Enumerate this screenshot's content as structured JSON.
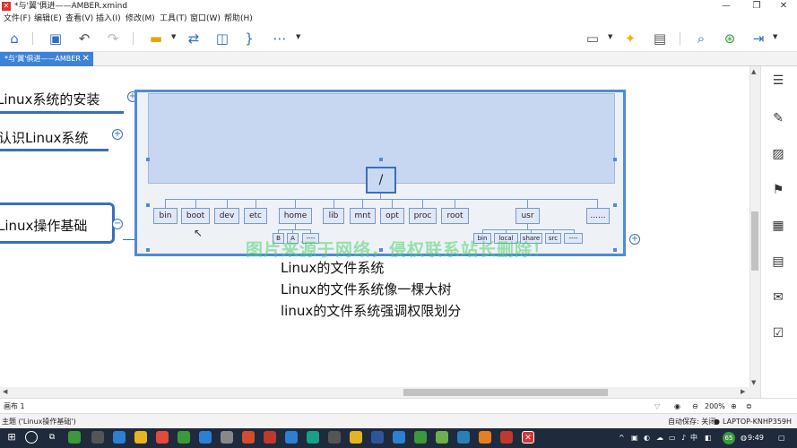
{
  "window": {
    "title": "*与'翼'俱进——AMBER.xmind",
    "app_icon": "xmind-icon"
  },
  "menu": [
    "文件(F)",
    "编辑(E)",
    "查看(V)",
    "插入(I)",
    "修改(M)",
    "工具(T)",
    "窗口(W)",
    "帮助(H)"
  ],
  "tab": {
    "label": "*与'翼'俱进——AMBER",
    "close": "✕"
  },
  "topics": [
    {
      "text": "Linux系统的安装",
      "plus": "+"
    },
    {
      "text": "认识Linux系统",
      "plus": "+"
    },
    {
      "text": "Linux操作基础",
      "minus": "−"
    }
  ],
  "diagram": {
    "root": "/",
    "children": [
      "bin",
      "boot",
      "dev",
      "etc",
      "home",
      "lib",
      "mnt",
      "opt",
      "proc",
      "root",
      "usr",
      "......"
    ],
    "home_children": [
      "B",
      "A",
      "----"
    ],
    "usr_children": [
      "bin",
      "local",
      "share",
      "src",
      "----"
    ]
  },
  "notes": [
    "Linux的文件系统",
    "Linux的文件系统像一棵大树",
    "linux的文件系统强调权限划分"
  ],
  "watermark": "图片来源于网络，侵权联系站长删除！",
  "expand_plus": "+",
  "status": {
    "sheet": "画布 1",
    "zoom": "200%",
    "topic": "主题 ('Linux操作基础')",
    "autosave": "自动保存: 关闭",
    "device": "LAPTOP-KNHP359H"
  },
  "taskbar": {
    "time": "9:49",
    "ime": "中",
    "badge": "65"
  },
  "colors": {
    "accent": "#3a6fb6",
    "tab": "#3c82d8",
    "watermark": "#4fd26c"
  }
}
